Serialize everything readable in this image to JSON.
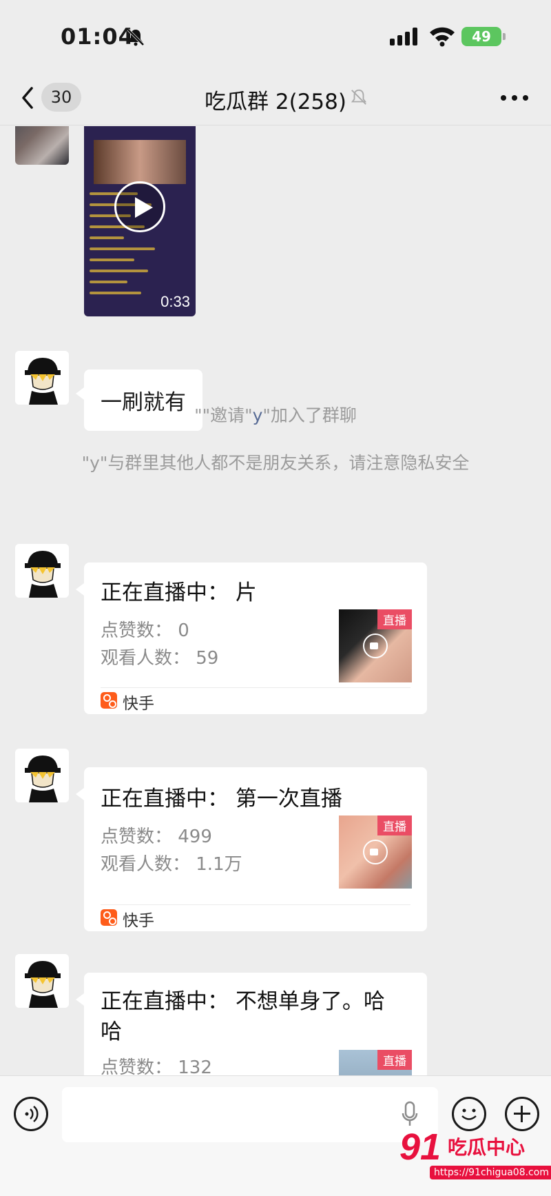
{
  "status_bar": {
    "time": "01:04",
    "battery": "49"
  },
  "nav": {
    "unread": "30",
    "title": "吃瓜群 2(258)"
  },
  "messages": {
    "video_duration": "0:33",
    "text_bubble": "一刷就有",
    "system_invite": {
      "part1": "\"\"邀请\"",
      "name": "y",
      "part2": "\"加入了群聊"
    },
    "system_privacy": "\"y\"与群里其他人都不是朋友关系，请注意隐私安全"
  },
  "live_cards": [
    {
      "title": "正在直播中：  片",
      "likes": "点赞数：  0",
      "viewers": "观看人数：  59",
      "tag": "直播",
      "source": "快手"
    },
    {
      "title": "正在直播中：  第一次直播",
      "likes": "点赞数：  499",
      "viewers": "观看人数：  1.1万",
      "tag": "直播",
      "source": "快手"
    },
    {
      "title": "正在直播中：  不想单身了。哈哈",
      "likes": "点赞数：  132",
      "tag": "直播"
    }
  ],
  "input": {
    "placeholder": ""
  },
  "watermark": {
    "number": "91",
    "text": "吃瓜中心",
    "url": "https://91chigua08.com"
  },
  "colors": {
    "background": "#ededed",
    "live_tag": "#ea4d64",
    "kuaishou": "#fe5c1a",
    "link": "#576b95",
    "battery": "#5cc65f"
  },
  "icons": [
    "back-icon",
    "bell-off-icon",
    "signal-icon",
    "wifi-icon",
    "battery-icon",
    "more-icon",
    "play-icon",
    "camera-icon",
    "kuaishou-icon",
    "voice-icon",
    "mic-icon",
    "emoji-icon",
    "plus-icon"
  ]
}
